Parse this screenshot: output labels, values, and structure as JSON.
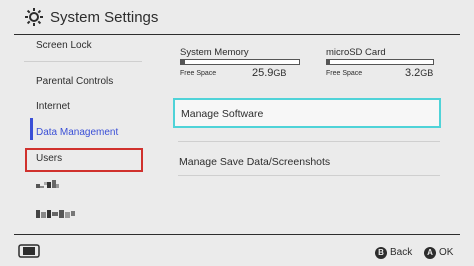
{
  "header": {
    "title": "System Settings",
    "icon": "gear-icon"
  },
  "sidebar": {
    "items": [
      {
        "label": "Screen Lock"
      },
      {
        "label": "Parental Controls"
      },
      {
        "label": "Internet"
      },
      {
        "label": "Data Management"
      },
      {
        "label": "Users"
      }
    ],
    "active_color": "#3a4fd6",
    "highlight_color": "#d0312d"
  },
  "storage": {
    "system_memory": {
      "label": "System Memory",
      "free_label": "Free Space",
      "free_value": "25.9",
      "free_unit": "GB",
      "used_fraction": 0.03
    },
    "microsd": {
      "label": "microSD Card",
      "free_label": "Free Space",
      "free_value": "3.2",
      "free_unit": "GB",
      "used_fraction": 0.03
    }
  },
  "main": {
    "manage_software": "Manage Software",
    "manage_save_data": "Manage Save Data/Screenshots",
    "focus_color": "#4fd3d8"
  },
  "footer": {
    "back_button": {
      "glyph": "B",
      "label": "Back"
    },
    "ok_button": {
      "glyph": "A",
      "label": "OK"
    },
    "console_icon": "switch-console-icon"
  }
}
